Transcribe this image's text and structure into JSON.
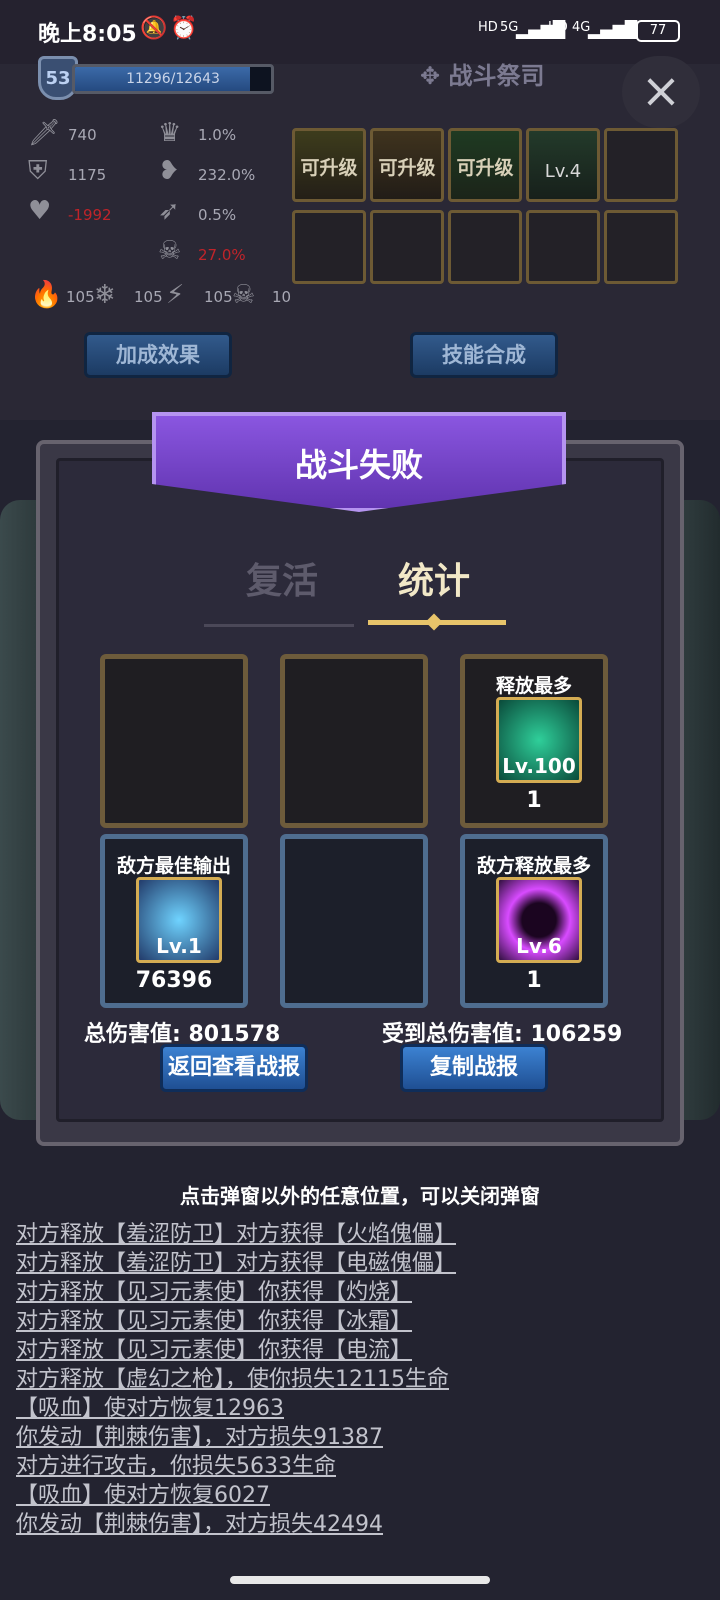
{
  "status_bar": {
    "time": "晚上8:05",
    "net1": "5G",
    "net2": "4G",
    "battery": "77"
  },
  "header": {
    "level": "53",
    "xp_text": "11296/12643",
    "xp_fraction": 0.894,
    "title": "战斗祭司",
    "close": "×"
  },
  "stats": {
    "attack": "740",
    "defense": "1175",
    "hp": "-1992",
    "crit": "1.0%",
    "lifesteal": "232.0%",
    "dodge": "0.5%",
    "skull_pct": "27.0%",
    "fire": "105",
    "ice": "105",
    "lightning": "105",
    "poison": "10"
  },
  "skill_slots": [
    {
      "text": "可升级"
    },
    {
      "text": "可升级"
    },
    {
      "text": "可升级"
    },
    {
      "text": "Lv.4"
    },
    {
      "text": ""
    },
    {
      "text": ""
    },
    {
      "text": ""
    },
    {
      "text": ""
    },
    {
      "text": ""
    },
    {
      "text": ""
    }
  ],
  "top_buttons": {
    "bonus": "加成效果",
    "synth": "技能合成"
  },
  "modal": {
    "title": "战斗失败",
    "tabs": {
      "revive": "复活",
      "stats": "统计"
    },
    "cards": [
      {
        "label": "",
        "lv": "",
        "num": ""
      },
      {
        "label": "",
        "lv": "",
        "num": ""
      },
      {
        "label": "释放最多",
        "lv": "Lv.100",
        "num": "1"
      },
      {
        "label": "敌方最佳输出",
        "lv": "Lv.1",
        "num": "76396"
      },
      {
        "label": "",
        "lv": "",
        "num": ""
      },
      {
        "label": "敌方释放最多",
        "lv": "Lv.6",
        "num": "1"
      }
    ],
    "total_damage": "总伤害值: 801578",
    "received_damage": "受到总伤害值: 106259",
    "btn_back": "返回查看战报",
    "btn_copy": "复制战报"
  },
  "hint": "点击弹窗以外的任意位置，可以关闭弹窗",
  "log": [
    "对方释放【羞涩防卫】对方获得【火焰傀儡】",
    "对方释放【羞涩防卫】对方获得【电磁傀儡】",
    "对方释放【见习元素使】你获得【灼烧】",
    "对方释放【见习元素使】你获得【冰霜】",
    "对方释放【见习元素使】你获得【电流】",
    "对方释放【虚幻之枪】，使你损失12115生命",
    "【吸血】使对方恢复12963",
    "你发动【荆棘伤害】，对方损失91387",
    "对方进行攻击，你损失5633生命",
    "【吸血】使对方恢复6027",
    "你发动【荆棘伤害】，对方损失42494"
  ]
}
